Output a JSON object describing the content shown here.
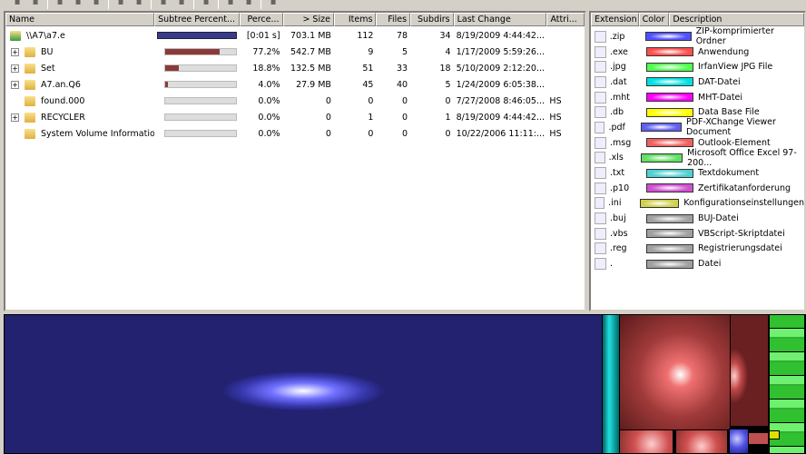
{
  "toolbar": {
    "icons": [
      "open-icon",
      "refresh-icon",
      "play-icon",
      "copy-icon",
      "explorer-icon",
      "cmd-icon",
      "refresh-selected-icon",
      "cleanup-icon",
      "delete-icon",
      "properties-icon",
      "zoom-in-icon",
      "zoom-out-icon",
      "help-icon"
    ]
  },
  "tree": {
    "columns": [
      "Name",
      "Subtree Percent...",
      "Perce...",
      "> Size",
      "Items",
      "Files",
      "Subdirs",
      "Last Change",
      "Attri..."
    ],
    "rows": [
      {
        "name": "\\\\A7\\a7.e",
        "expand": false,
        "root": true,
        "bar": 1.0,
        "percent": "[0:01 s]",
        "size": "703.1 MB",
        "items": "112",
        "files": "78",
        "subdirs": "34",
        "changed": "8/19/2009  4:44:42...",
        "attr": ""
      },
      {
        "name": "BU",
        "expand": true,
        "bar": 0.772,
        "percent": "77.2%",
        "size": "542.7 MB",
        "items": "9",
        "files": "5",
        "subdirs": "4",
        "changed": "1/17/2009  5:59:26...",
        "attr": ""
      },
      {
        "name": "Set",
        "expand": true,
        "bar": 0.188,
        "percent": "18.8%",
        "size": "132.5 MB",
        "items": "51",
        "files": "33",
        "subdirs": "18",
        "changed": "5/10/2009  2:12:20...",
        "attr": ""
      },
      {
        "name": "A7.an.Q6",
        "expand": true,
        "bar": 0.04,
        "percent": "4.0%",
        "size": "27.9 MB",
        "items": "45",
        "files": "40",
        "subdirs": "5",
        "changed": "1/24/2009  6:05:38...",
        "attr": ""
      },
      {
        "name": "found.000",
        "expand": false,
        "bar": 0,
        "percent": "0.0%",
        "size": "0",
        "items": "0",
        "files": "0",
        "subdirs": "0",
        "changed": "7/27/2008  8:46:05...",
        "attr": "HS"
      },
      {
        "name": "RECYCLER",
        "expand": true,
        "bar": 0,
        "percent": "0.0%",
        "size": "0",
        "items": "1",
        "files": "0",
        "subdirs": "1",
        "changed": "8/19/2009  4:44:42...",
        "attr": "HS"
      },
      {
        "name": "System Volume Information",
        "expand": false,
        "bar": 0,
        "percent": "0.0%",
        "size": "0",
        "items": "0",
        "files": "0",
        "subdirs": "0",
        "changed": "10/22/2006  11:11:...",
        "attr": "HS"
      }
    ]
  },
  "extensions": {
    "columns": [
      "Extension",
      "Color",
      "Description"
    ],
    "rows": [
      {
        "ext": ".zip",
        "color": "#5050ff",
        "desc": "ZIP-komprimierter Ordner"
      },
      {
        "ext": ".exe",
        "color": "#ff5050",
        "desc": "Anwendung"
      },
      {
        "ext": ".jpg",
        "color": "#50ff50",
        "desc": "IrfanView JPG File"
      },
      {
        "ext": ".dat",
        "color": "#00e0e0",
        "desc": "DAT-Datei"
      },
      {
        "ext": ".mht",
        "color": "#ff00ff",
        "desc": "MHT-Datei"
      },
      {
        "ext": ".db",
        "color": "#ffff00",
        "desc": "Data Base File"
      },
      {
        "ext": ".pdf",
        "color": "#6060f0",
        "desc": "PDF-XChange Viewer Document"
      },
      {
        "ext": ".msg",
        "color": "#f06060",
        "desc": "Outlook-Element"
      },
      {
        "ext": ".xls",
        "color": "#60e060",
        "desc": "Microsoft Office Excel 97-200..."
      },
      {
        "ext": ".txt",
        "color": "#50d0d0",
        "desc": "Textdokument"
      },
      {
        "ext": ".p10",
        "color": "#d050d0",
        "desc": "Zertifikatanforderung"
      },
      {
        "ext": ".ini",
        "color": "#d0d050",
        "desc": "Konfigurationseinstellungen"
      },
      {
        "ext": ".buj",
        "color": "#a0a0a0",
        "desc": "BUJ-Datei"
      },
      {
        "ext": ".vbs",
        "color": "#a0a0a0",
        "desc": "VBScript-Skriptdatei"
      },
      {
        "ext": ".reg",
        "color": "#a0a0a0",
        "desc": "Registrierungsdatei"
      },
      {
        "ext": ".",
        "color": "#a0a0a0",
        "desc": "Datei"
      }
    ]
  }
}
